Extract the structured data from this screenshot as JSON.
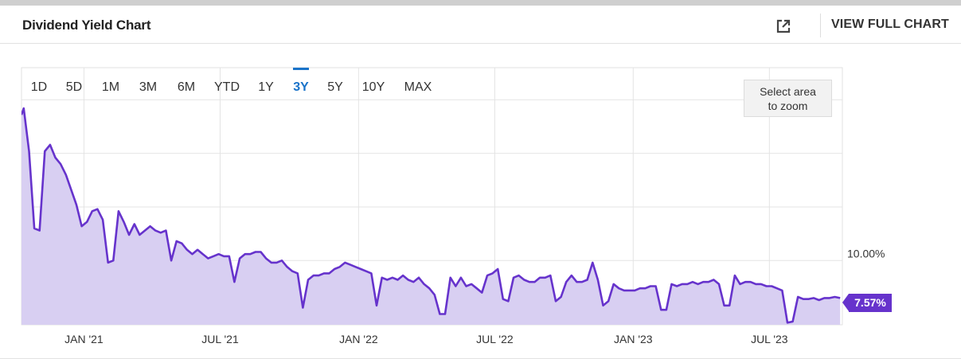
{
  "header": {
    "title": "Dividend Yield Chart",
    "full_chart_label": "VIEW FULL CHART",
    "external_icon": "external-link-icon"
  },
  "ranges": [
    "1D",
    "5D",
    "1M",
    "3M",
    "6M",
    "YTD",
    "1Y",
    "3Y",
    "5Y",
    "10Y",
    "MAX"
  ],
  "active_range": "3Y",
  "zoom_hint": {
    "line1": "Select area",
    "line2": "to zoom"
  },
  "colors": {
    "line": "#6633cc",
    "fill": "#d8cff2",
    "active": "#1a73c9"
  },
  "chart_data": {
    "type": "area",
    "title": "Dividend Yield Chart",
    "xlabel": "",
    "ylabel": "",
    "x_ticks": [
      "JAN '21",
      "JUL '21",
      "JAN '22",
      "JUL '22",
      "JAN '23",
      "JUL '23"
    ],
    "x_tick_dates": [
      "2021-01-01",
      "2021-07-01",
      "2022-01-01",
      "2022-07-01",
      "2023-01-01",
      "2023-07-01"
    ],
    "y_ticks": [
      "10.00%"
    ],
    "y_tick_values": [
      10.0
    ],
    "xlim": [
      "2020-10-10",
      "2023-10-06"
    ],
    "ylim": [
      7.0,
      19.0
    ],
    "grid": true,
    "last_value": 7.57,
    "last_label": "7.57%",
    "series": [
      {
        "points": [
          [
            "2020-10-10",
            16.8
          ],
          [
            "2020-10-13",
            17.1
          ],
          [
            "2020-10-20",
            15.1
          ],
          [
            "2020-10-27",
            11.5
          ],
          [
            "2020-11-03",
            11.4
          ],
          [
            "2020-11-10",
            15.1
          ],
          [
            "2020-11-17",
            15.4
          ],
          [
            "2020-11-24",
            14.8
          ],
          [
            "2020-12-01",
            14.5
          ],
          [
            "2020-12-08",
            14.0
          ],
          [
            "2020-12-15",
            13.3
          ],
          [
            "2020-12-22",
            12.6
          ],
          [
            "2020-12-29",
            11.6
          ],
          [
            "2021-01-05",
            11.8
          ],
          [
            "2021-01-12",
            12.3
          ],
          [
            "2021-01-19",
            12.4
          ],
          [
            "2021-01-26",
            11.9
          ],
          [
            "2021-02-02",
            9.9
          ],
          [
            "2021-02-09",
            10.0
          ],
          [
            "2021-02-16",
            12.3
          ],
          [
            "2021-02-23",
            11.8
          ],
          [
            "2021-03-02",
            11.2
          ],
          [
            "2021-03-09",
            11.7
          ],
          [
            "2021-03-16",
            11.2
          ],
          [
            "2021-03-23",
            11.4
          ],
          [
            "2021-03-30",
            11.6
          ],
          [
            "2021-04-06",
            11.4
          ],
          [
            "2021-04-13",
            11.3
          ],
          [
            "2021-04-20",
            11.4
          ],
          [
            "2021-04-27",
            10.0
          ],
          [
            "2021-05-04",
            10.9
          ],
          [
            "2021-05-11",
            10.8
          ],
          [
            "2021-05-18",
            10.5
          ],
          [
            "2021-05-25",
            10.3
          ],
          [
            "2021-06-01",
            10.5
          ],
          [
            "2021-06-08",
            10.3
          ],
          [
            "2021-06-15",
            10.1
          ],
          [
            "2021-06-22",
            10.2
          ],
          [
            "2021-06-29",
            10.3
          ],
          [
            "2021-07-06",
            10.2
          ],
          [
            "2021-07-13",
            10.2
          ],
          [
            "2021-07-20",
            9.0
          ],
          [
            "2021-07-27",
            10.1
          ],
          [
            "2021-08-03",
            10.3
          ],
          [
            "2021-08-10",
            10.3
          ],
          [
            "2021-08-17",
            10.4
          ],
          [
            "2021-08-24",
            10.4
          ],
          [
            "2021-08-31",
            10.1
          ],
          [
            "2021-09-07",
            9.9
          ],
          [
            "2021-09-14",
            9.9
          ],
          [
            "2021-09-21",
            10.0
          ],
          [
            "2021-09-28",
            9.7
          ],
          [
            "2021-10-05",
            9.5
          ],
          [
            "2021-10-12",
            9.4
          ],
          [
            "2021-10-19",
            7.8
          ],
          [
            "2021-10-26",
            9.1
          ],
          [
            "2021-11-02",
            9.3
          ],
          [
            "2021-11-09",
            9.3
          ],
          [
            "2021-11-16",
            9.4
          ],
          [
            "2021-11-23",
            9.4
          ],
          [
            "2021-11-30",
            9.6
          ],
          [
            "2021-12-07",
            9.7
          ],
          [
            "2021-12-14",
            9.9
          ],
          [
            "2021-12-21",
            9.8
          ],
          [
            "2021-12-28",
            9.7
          ],
          [
            "2022-01-04",
            9.6
          ],
          [
            "2022-01-11",
            9.5
          ],
          [
            "2022-01-18",
            9.4
          ],
          [
            "2022-01-25",
            7.9
          ],
          [
            "2022-02-01",
            9.2
          ],
          [
            "2022-02-08",
            9.1
          ],
          [
            "2022-02-15",
            9.2
          ],
          [
            "2022-02-22",
            9.1
          ],
          [
            "2022-03-01",
            9.3
          ],
          [
            "2022-03-08",
            9.1
          ],
          [
            "2022-03-15",
            9.0
          ],
          [
            "2022-03-22",
            9.2
          ],
          [
            "2022-03-29",
            8.9
          ],
          [
            "2022-04-05",
            8.7
          ],
          [
            "2022-04-12",
            8.4
          ],
          [
            "2022-04-19",
            7.5
          ],
          [
            "2022-04-26",
            7.5
          ],
          [
            "2022-05-03",
            9.2
          ],
          [
            "2022-05-10",
            8.8
          ],
          [
            "2022-05-17",
            9.2
          ],
          [
            "2022-05-24",
            8.8
          ],
          [
            "2022-05-31",
            8.9
          ],
          [
            "2022-06-07",
            8.7
          ],
          [
            "2022-06-14",
            8.5
          ],
          [
            "2022-06-21",
            9.3
          ],
          [
            "2022-06-28",
            9.4
          ],
          [
            "2022-07-05",
            9.6
          ],
          [
            "2022-07-12",
            8.2
          ],
          [
            "2022-07-19",
            8.1
          ],
          [
            "2022-07-26",
            9.2
          ],
          [
            "2022-08-02",
            9.3
          ],
          [
            "2022-08-09",
            9.1
          ],
          [
            "2022-08-16",
            9.0
          ],
          [
            "2022-08-23",
            9.0
          ],
          [
            "2022-08-30",
            9.2
          ],
          [
            "2022-09-06",
            9.2
          ],
          [
            "2022-09-13",
            9.3
          ],
          [
            "2022-09-20",
            8.1
          ],
          [
            "2022-09-27",
            8.3
          ],
          [
            "2022-10-04",
            9.0
          ],
          [
            "2022-10-11",
            9.3
          ],
          [
            "2022-10-18",
            9.0
          ],
          [
            "2022-10-25",
            9.0
          ],
          [
            "2022-11-01",
            9.1
          ],
          [
            "2022-11-08",
            9.9
          ],
          [
            "2022-11-15",
            9.1
          ],
          [
            "2022-11-22",
            7.9
          ],
          [
            "2022-11-29",
            8.1
          ],
          [
            "2022-12-06",
            8.9
          ],
          [
            "2022-12-13",
            8.7
          ],
          [
            "2022-12-20",
            8.6
          ],
          [
            "2022-12-27",
            8.6
          ],
          [
            "2023-01-03",
            8.6
          ],
          [
            "2023-01-10",
            8.7
          ],
          [
            "2023-01-17",
            8.7
          ],
          [
            "2023-01-24",
            8.8
          ],
          [
            "2023-01-31",
            8.8
          ],
          [
            "2023-02-07",
            7.7
          ],
          [
            "2023-02-14",
            7.7
          ],
          [
            "2023-02-21",
            8.9
          ],
          [
            "2023-02-28",
            8.8
          ],
          [
            "2023-03-07",
            8.9
          ],
          [
            "2023-03-14",
            8.9
          ],
          [
            "2023-03-21",
            9.0
          ],
          [
            "2023-03-28",
            8.9
          ],
          [
            "2023-04-04",
            9.0
          ],
          [
            "2023-04-11",
            9.0
          ],
          [
            "2023-04-18",
            9.1
          ],
          [
            "2023-04-25",
            8.9
          ],
          [
            "2023-05-02",
            7.9
          ],
          [
            "2023-05-09",
            7.9
          ],
          [
            "2023-05-16",
            9.3
          ],
          [
            "2023-05-23",
            8.9
          ],
          [
            "2023-05-30",
            9.0
          ],
          [
            "2023-06-06",
            9.0
          ],
          [
            "2023-06-13",
            8.9
          ],
          [
            "2023-06-20",
            8.9
          ],
          [
            "2023-06-27",
            8.8
          ],
          [
            "2023-07-04",
            8.8
          ],
          [
            "2023-07-11",
            8.7
          ],
          [
            "2023-07-18",
            8.6
          ],
          [
            "2023-07-25",
            7.1
          ],
          [
            "2023-08-01",
            7.15
          ],
          [
            "2023-08-08",
            8.3
          ],
          [
            "2023-08-15",
            8.2
          ],
          [
            "2023-08-22",
            8.2
          ],
          [
            "2023-08-29",
            8.25
          ],
          [
            "2023-09-05",
            8.15
          ],
          [
            "2023-09-12",
            8.25
          ],
          [
            "2023-09-19",
            8.25
          ],
          [
            "2023-09-26",
            8.3
          ],
          [
            "2023-10-03",
            8.25
          ]
        ]
      }
    ]
  }
}
